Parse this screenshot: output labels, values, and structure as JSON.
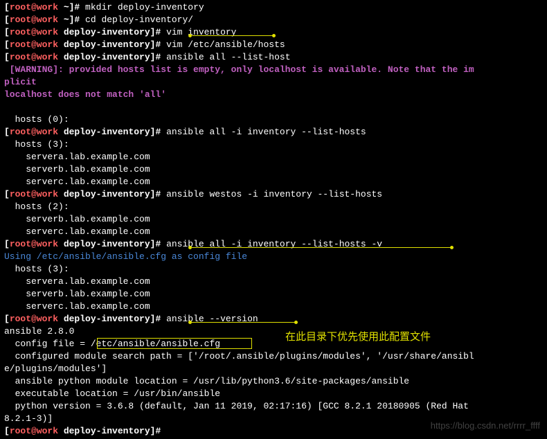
{
  "lines": [
    {
      "type": "prompt",
      "path": "~",
      "cmd": "mkdir deploy-inventory"
    },
    {
      "type": "prompt",
      "path": "~",
      "cmd": "cd deploy-inventory/"
    },
    {
      "type": "prompt",
      "path": "deploy-inventory",
      "cmd": "vim inventory"
    },
    {
      "type": "prompt",
      "path": "deploy-inventory",
      "cmd": "vim /etc/ansible/hosts"
    },
    {
      "type": "prompt",
      "path": "deploy-inventory",
      "cmd": "ansible all --list-host"
    },
    {
      "type": "warn",
      "text": " [WARNING]: provided hosts list is empty, only localhost is available. Note that the im"
    },
    {
      "type": "warn",
      "text": "plicit"
    },
    {
      "type": "warn",
      "text": "localhost does not match 'all'"
    },
    {
      "type": "blank",
      "text": ""
    },
    {
      "type": "out",
      "text": "  hosts (0):"
    },
    {
      "type": "prompt",
      "path": "deploy-inventory",
      "cmd": "ansible all -i inventory --list-hosts"
    },
    {
      "type": "out",
      "text": "  hosts (3):"
    },
    {
      "type": "out",
      "text": "    servera.lab.example.com"
    },
    {
      "type": "out",
      "text": "    serverb.lab.example.com"
    },
    {
      "type": "out",
      "text": "    serverc.lab.example.com"
    },
    {
      "type": "prompt",
      "path": "deploy-inventory",
      "cmd": "ansible westos -i inventory --list-hosts"
    },
    {
      "type": "out",
      "text": "  hosts (2):"
    },
    {
      "type": "out",
      "text": "    serverb.lab.example.com"
    },
    {
      "type": "out",
      "text": "    serverc.lab.example.com"
    },
    {
      "type": "prompt",
      "path": "deploy-inventory",
      "cmd": "ansible all -i inventory --list-hosts -v"
    },
    {
      "type": "cfg",
      "text": "Using /etc/ansible/ansible.cfg as config file"
    },
    {
      "type": "out",
      "text": "  hosts (3):"
    },
    {
      "type": "out",
      "text": "    servera.lab.example.com"
    },
    {
      "type": "out",
      "text": "    serverb.lab.example.com"
    },
    {
      "type": "out",
      "text": "    serverc.lab.example.com"
    },
    {
      "type": "prompt",
      "path": "deploy-inventory",
      "cmd": "ansible --version"
    },
    {
      "type": "out",
      "text": "ansible 2.8.0"
    },
    {
      "type": "out",
      "text": "  config file = /etc/ansible/ansible.cfg"
    },
    {
      "type": "out",
      "text": "  configured module search path = ['/root/.ansible/plugins/modules', '/usr/share/ansibl"
    },
    {
      "type": "out",
      "text": "e/plugins/modules']"
    },
    {
      "type": "out",
      "text": "  ansible python module location = /usr/lib/python3.6/site-packages/ansible"
    },
    {
      "type": "out",
      "text": "  executable location = /usr/bin/ansible"
    },
    {
      "type": "out",
      "text": "  python version = 3.6.8 (default, Jan 11 2019, 02:17:16) [GCC 8.2.1 20180905 (Red Hat "
    },
    {
      "type": "out",
      "text": "8.2.1-3)]"
    },
    {
      "type": "prompt",
      "path": "deploy-inventory",
      "cmd": ""
    }
  ],
  "prompt": {
    "userhost": "root@work",
    "sep_open": "[",
    "sep_close": "]",
    "hash": "# "
  },
  "annotation": "在此目录下优先使用此配置文件",
  "watermark": "https://blog.csdn.net/rrrr_ffff"
}
